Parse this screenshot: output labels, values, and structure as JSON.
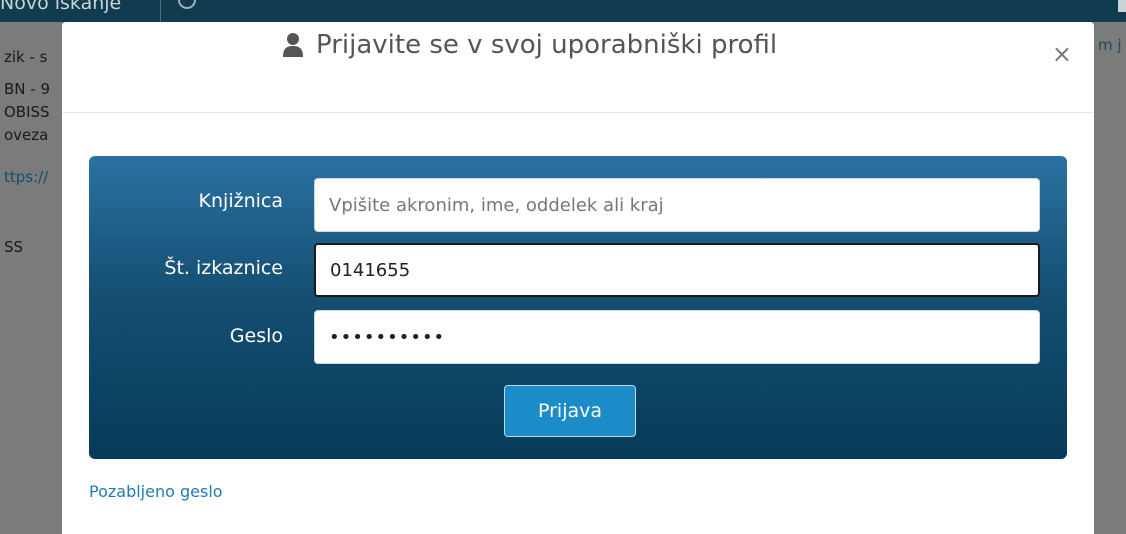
{
  "background": {
    "topbar_text": "Novo iskanje",
    "left_lines": [
      "zik - s",
      "BN - 9",
      "OBISS",
      "oveza",
      "ttps://",
      "SS"
    ],
    "right_text": "m j"
  },
  "modal": {
    "title": "Prijavite se v svoj uporabniški profil",
    "title_icon": "user-icon",
    "close_label": "×"
  },
  "form": {
    "library": {
      "label": "Knjižnica",
      "value": "",
      "placeholder": "Vpišite akronim, ime, oddelek ali kraj"
    },
    "card_number": {
      "label": "Št. izkaznice",
      "value": "0141655",
      "placeholder": ""
    },
    "password": {
      "label": "Geslo",
      "value": "••••••••••",
      "placeholder": ""
    },
    "submit_label": "Prijava"
  },
  "forgot_password_label": "Pozabljeno geslo",
  "colors": {
    "panel_top": "#2a72a1",
    "panel_bottom": "#063b58",
    "button": "#1b8cc7",
    "link": "#1f7bb4"
  }
}
